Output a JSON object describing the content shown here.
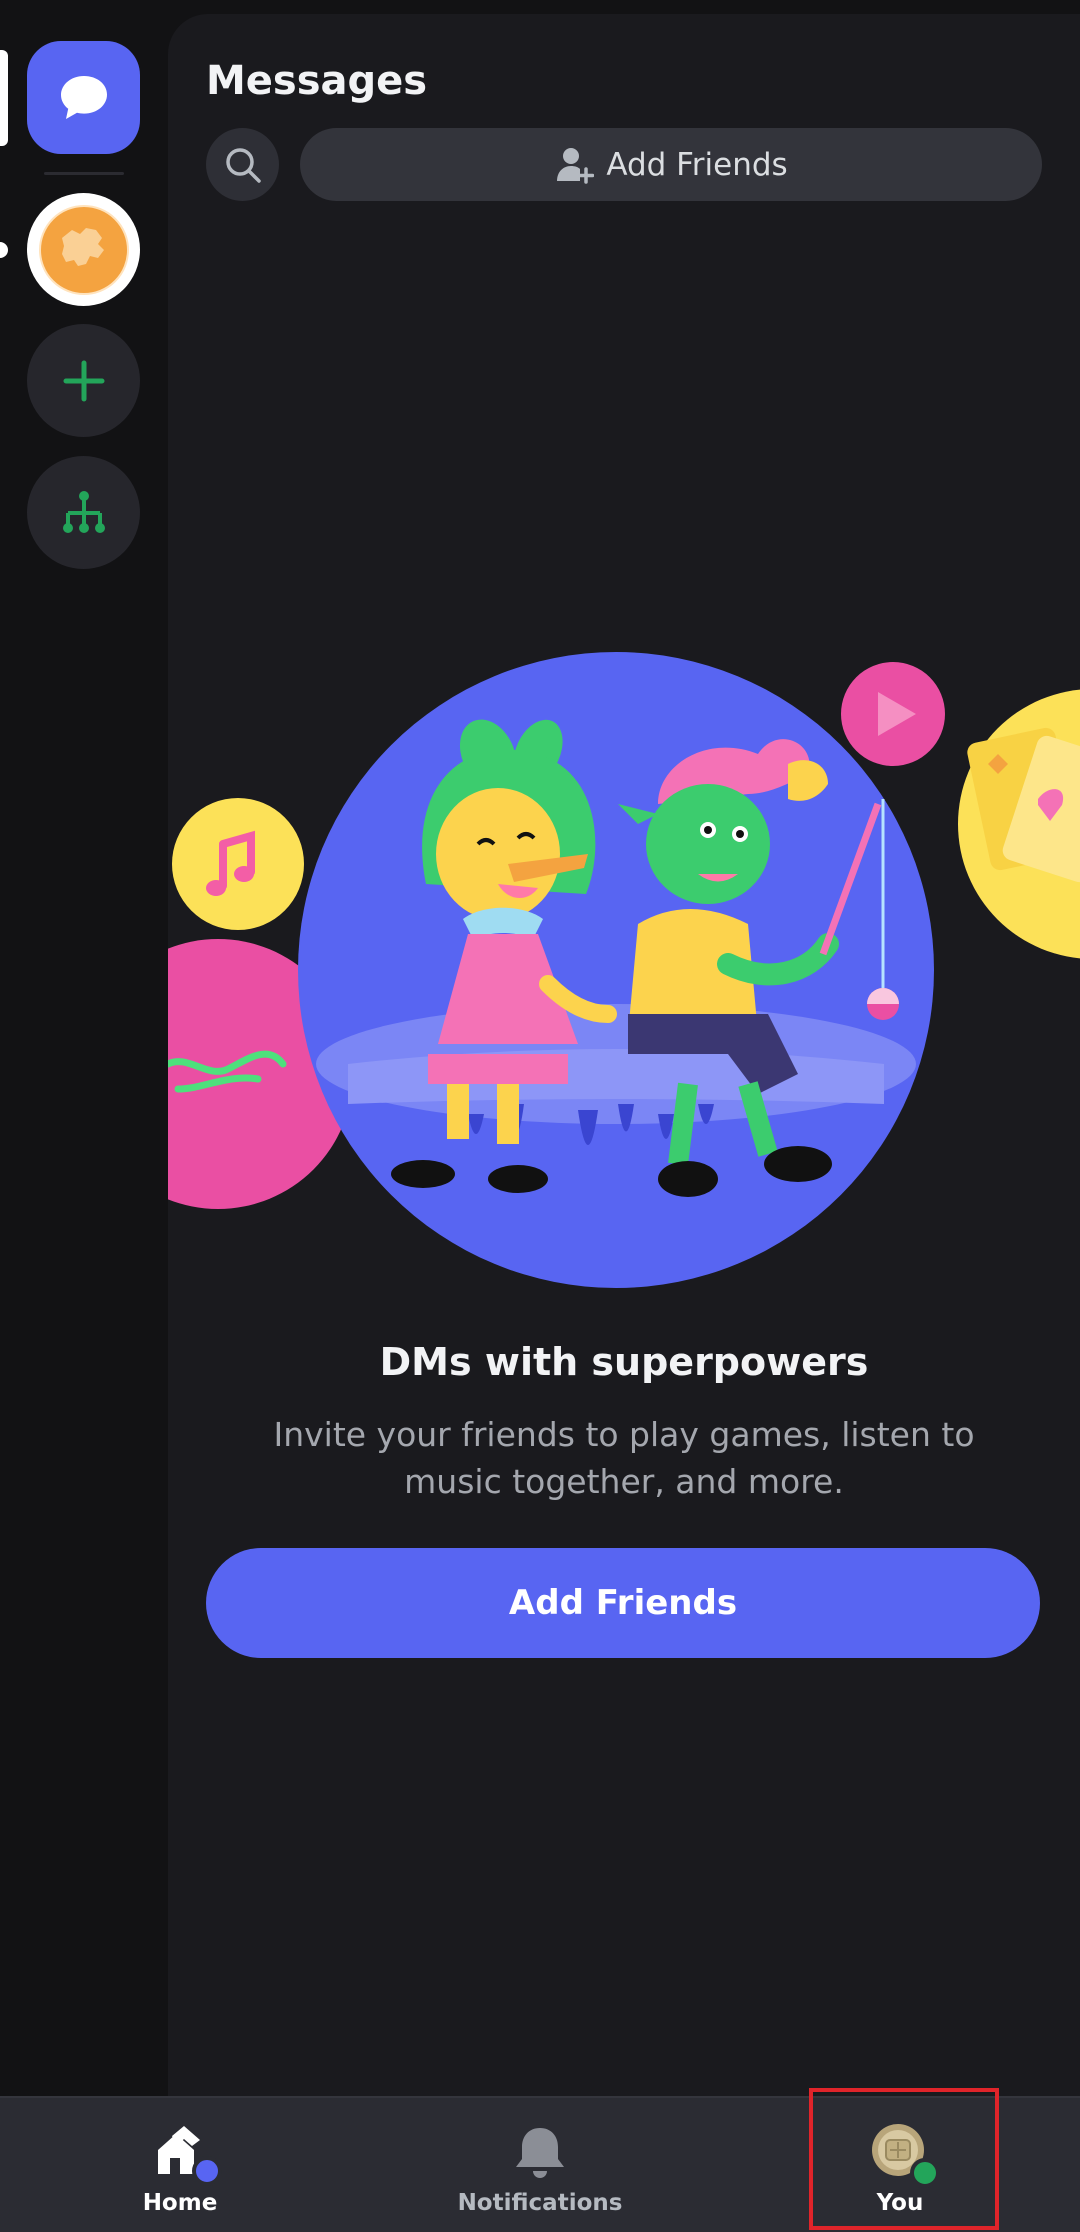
{
  "header": {
    "title": "Messages",
    "add_friends_label": "Add Friends"
  },
  "empty_state": {
    "heading": "DMs with superpowers",
    "subtext": "Invite your friends to play games, listen to music together, and more.",
    "cta_label": "Add Friends"
  },
  "bottom_nav": {
    "items": [
      {
        "label": "Home",
        "icon": "home-icon"
      },
      {
        "label": "Notifications",
        "icon": "bell-icon"
      },
      {
        "label": "You",
        "icon": "avatar"
      }
    ]
  },
  "colors": {
    "brand": "#5865f2",
    "online": "#23a55a",
    "background": "#1a1a1e",
    "rail": "#121214"
  }
}
